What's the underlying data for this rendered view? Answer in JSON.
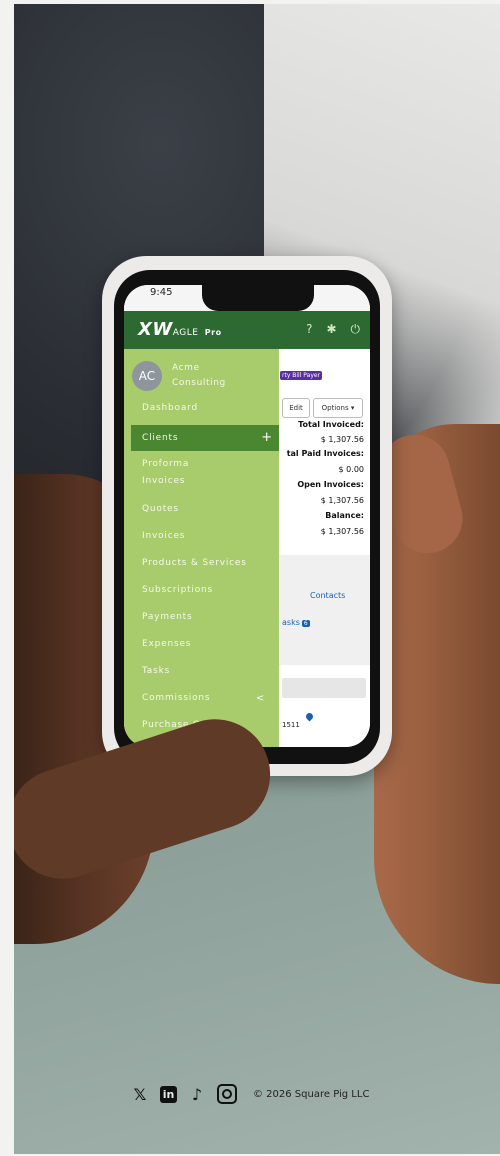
{
  "status": {
    "time": "9:45"
  },
  "brand": {
    "logo_mark": "XW",
    "logo_text": "AGLE",
    "tier": "Pro"
  },
  "account": {
    "initials": "AC",
    "company_line1": "Acme",
    "company_line2": "Consulting"
  },
  "menu": {
    "items": [
      {
        "label": "Dashboard"
      },
      {
        "label": "Clients",
        "action": "+"
      },
      {
        "label": "Proforma"
      },
      {
        "label": "Invoices"
      },
      {
        "label": "Quotes"
      },
      {
        "label": "Invoices"
      },
      {
        "label": "Products & Services"
      },
      {
        "label": "Subscriptions"
      },
      {
        "label": "Payments"
      },
      {
        "label": "Expenses"
      },
      {
        "label": "Tasks"
      },
      {
        "label": "Commissions",
        "action": "<"
      },
      {
        "label": "Purchase Orders"
      }
    ]
  },
  "client": {
    "badge": "rty Bill Payer",
    "edit_label": "Edit",
    "options_label": "Options",
    "total_invoiced_label": "Total Invoiced:",
    "total_invoiced_value": "$ 1,307.56",
    "total_paid_label": "tal Paid Invoices:",
    "total_paid_value": "$ 0.00",
    "open_label": "Open Invoices:",
    "open_value": "$ 1,307.56",
    "balance_label": "Balance:",
    "balance_value": "$ 1,307.56",
    "contacts_link": "Contacts",
    "tasks_link": "asks",
    "tasks_count": "6",
    "address_fragment": "1511"
  },
  "footer": {
    "x_icon": "𝕏",
    "linkedin_icon": "in",
    "tiktok_icon": "♪",
    "copyright": "© 2026 Square Pig LLC"
  },
  "colors": {
    "brand_dark": "#2d6a31",
    "menu_green": "#a8cc6c",
    "menu_active": "#4a8730"
  }
}
